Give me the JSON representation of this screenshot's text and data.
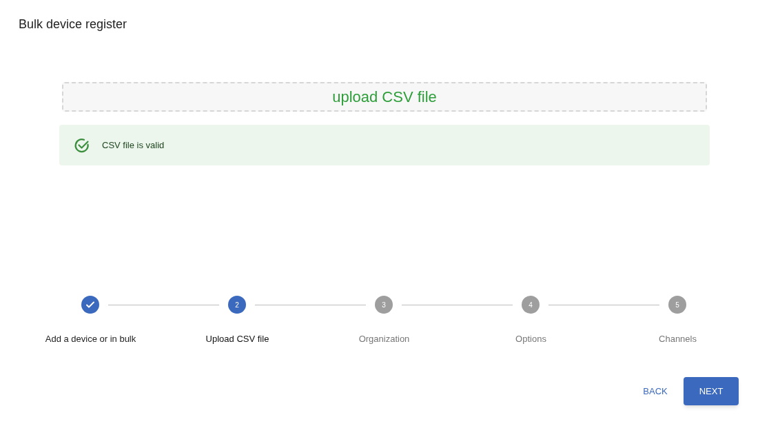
{
  "title": "Bulk device register",
  "upload": {
    "label": "upload CSV file"
  },
  "alert": {
    "message": "CSV file is valid"
  },
  "steps": [
    {
      "label": "Add a device or in bulk",
      "completed": true,
      "selected": false
    },
    {
      "number": "2",
      "label": "Upload CSV file",
      "completed": false,
      "selected": true
    },
    {
      "number": "3",
      "label": "Organization",
      "completed": false,
      "selected": false
    },
    {
      "number": "4",
      "label": "Options",
      "completed": false,
      "selected": false
    },
    {
      "number": "5",
      "label": "Channels",
      "completed": false,
      "selected": false
    }
  ],
  "buttons": {
    "back": "BACK",
    "next": "NEXT"
  }
}
